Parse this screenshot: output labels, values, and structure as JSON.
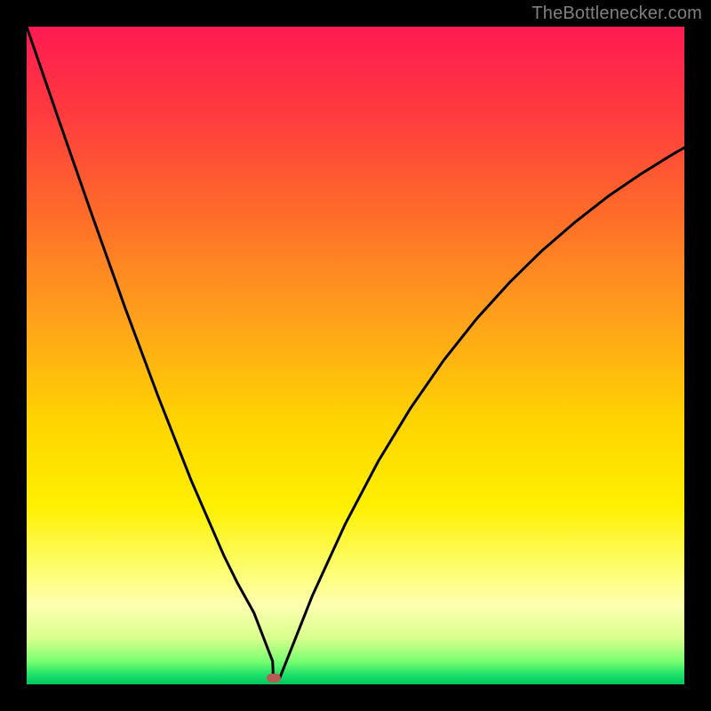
{
  "attribution": "TheBottlenecker.com",
  "chart_data": {
    "type": "line",
    "title": "",
    "xlabel": "",
    "ylabel": "",
    "x_range": [
      0,
      100
    ],
    "y_range": [
      0,
      100
    ],
    "x": [
      0.0,
      4.996,
      9.992,
      14.988,
      19.984,
      24.98,
      29.976,
      32.05,
      34.55,
      37.4,
      37.5,
      38.46,
      43.45,
      48.45,
      53.45,
      58.44,
      63.43,
      68.43,
      73.42,
      78.42,
      83.41,
      88.41,
      93.4,
      98.4,
      100.0
    ],
    "values": [
      100.0,
      85.5,
      71.2,
      57.2,
      43.8,
      31.1,
      19.6,
      15.4,
      10.9,
      3.5,
      0.9,
      0.9,
      13.5,
      24.4,
      33.9,
      42.1,
      49.3,
      55.6,
      61.1,
      66.0,
      70.3,
      74.2,
      77.6,
      80.7,
      81.6
    ],
    "marker": {
      "x": 37.5,
      "y": 0.9
    },
    "gradient_stops": [
      {
        "offset": 0.0,
        "color": "#ff1a52"
      },
      {
        "offset": 0.13,
        "color": "#ff3a3f"
      },
      {
        "offset": 0.28,
        "color": "#ff6a2a"
      },
      {
        "offset": 0.45,
        "color": "#ffa31a"
      },
      {
        "offset": 0.6,
        "color": "#ffd400"
      },
      {
        "offset": 0.73,
        "color": "#fff000"
      },
      {
        "offset": 0.82,
        "color": "#fdfd6a"
      },
      {
        "offset": 0.88,
        "color": "#feffb0"
      },
      {
        "offset": 0.93,
        "color": "#d8ff8c"
      },
      {
        "offset": 0.965,
        "color": "#7aff70"
      },
      {
        "offset": 0.985,
        "color": "#1fe06a"
      },
      {
        "offset": 1.0,
        "color": "#00c85f"
      }
    ]
  }
}
